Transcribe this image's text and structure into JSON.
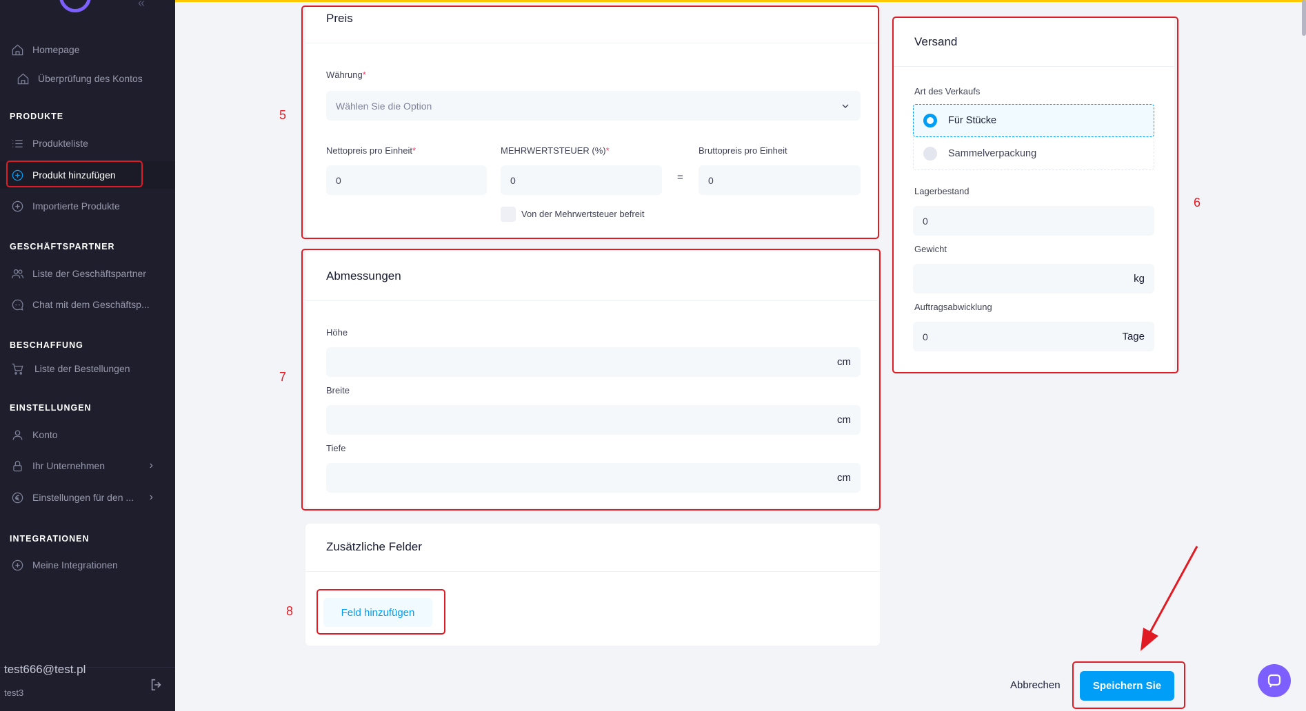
{
  "sidebar": {
    "top_items": [
      {
        "label": "Homepage",
        "icon": "home-icon"
      },
      {
        "label": "Überprüfung des Kontos",
        "icon": "home-icon"
      }
    ],
    "sections": {
      "produkte": "PRODUKTE",
      "partner": "GESCHÄFTSPARTNER",
      "beschaffung": "BESCHAFFUNG",
      "einstellungen": "EINSTELLUNGEN",
      "integrationen": "INTEGRATIONEN"
    },
    "items": {
      "produkteliste": "Produkteliste",
      "produkt_hinzufuegen": "Produkt hinzufügen",
      "importierte": "Importierte Produkte",
      "partner_liste": "Liste der Geschäftspartner",
      "partner_chat": "Chat mit dem Geschäftsp...",
      "bestellungen": "Liste der Bestellungen",
      "konto": "Konto",
      "unternehmen": "Ihr Unternehmen",
      "einstellungen_den": "Einstellungen für den ...",
      "integrationen": "Meine Integrationen"
    },
    "user": {
      "email": "test666@test.pl",
      "name": "test3"
    }
  },
  "preis": {
    "title": "Preis",
    "currency_label": "Währung",
    "currency_placeholder": "Wählen Sie die Option",
    "net_label": "Nettopreis pro Einheit",
    "net_value": "0",
    "vat_label": "MEHRWERTSTEUER (%)",
    "vat_value": "0",
    "equals": "=",
    "gross_label": "Bruttopreis pro Einheit",
    "gross_value": "0",
    "vat_exempt_label": "Von der Mehrwertsteuer befreit"
  },
  "abmessungen": {
    "title": "Abmessungen",
    "hoehe_label": "Höhe",
    "breite_label": "Breite",
    "tiefe_label": "Tiefe",
    "unit": "cm"
  },
  "zusatz": {
    "title": "Zusätzliche Felder",
    "add_button": "Feld hinzufügen"
  },
  "versand": {
    "title": "Versand",
    "sale_type_label": "Art des Verkaufs",
    "options": [
      "Für Stücke",
      "Sammelverpackung"
    ],
    "selected": "Für Stücke",
    "stock_label": "Lagerbestand",
    "stock_value": "0",
    "weight_label": "Gewicht",
    "weight_unit": "kg",
    "handling_label": "Auftragsabwicklung",
    "handling_value": "0",
    "handling_unit": "Tage"
  },
  "footer": {
    "cancel": "Abbrechen",
    "save": "Speichern Sie"
  },
  "annotations": [
    "5",
    "6",
    "7",
    "8"
  ],
  "colors": {
    "sidebar_bg": "#1e1e2d",
    "primary": "#009ef7",
    "annotation_red": "#e01b24",
    "top_accent": "#ffc700",
    "chat_purple": "#7d5ffe"
  }
}
